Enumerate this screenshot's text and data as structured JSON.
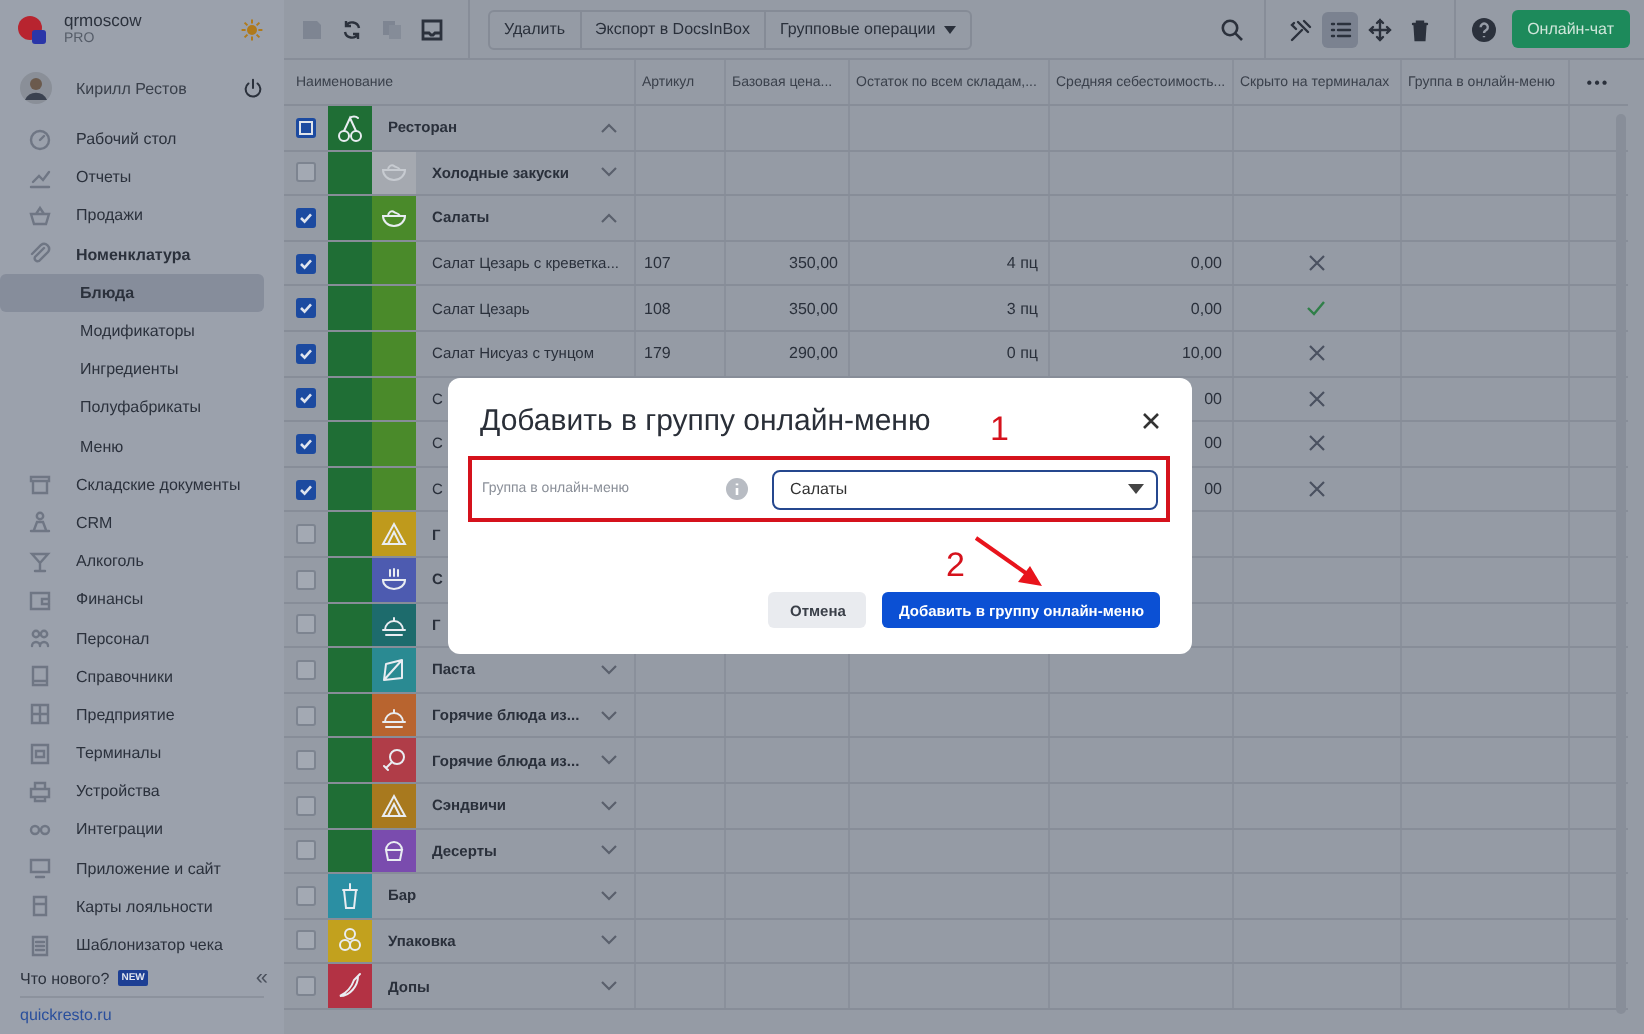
{
  "app": {
    "account": "qrmoscow",
    "plan": "PRO"
  },
  "user": {
    "name": "Кирилл Рестов"
  },
  "sidebar": {
    "items": [
      {
        "label": "Рабочий стол",
        "selected": false
      },
      {
        "label": "Отчеты",
        "selected": false
      },
      {
        "label": "Продажи",
        "selected": false
      },
      {
        "label": "Номенклатура",
        "selected": false,
        "expanded": true,
        "children": [
          {
            "label": "Блюда",
            "selected": true
          },
          {
            "label": "Модификаторы",
            "selected": false
          },
          {
            "label": "Ингредиенты",
            "selected": false
          },
          {
            "label": "Полуфабрикаты",
            "selected": false
          },
          {
            "label": "Меню",
            "selected": false
          }
        ]
      },
      {
        "label": "Складские документы",
        "selected": false
      },
      {
        "label": "CRM",
        "selected": false
      },
      {
        "label": "Алкоголь",
        "selected": false
      },
      {
        "label": "Финансы",
        "selected": false
      },
      {
        "label": "Персонал",
        "selected": false
      },
      {
        "label": "Справочники",
        "selected": false
      },
      {
        "label": "Предприятие",
        "selected": false
      },
      {
        "label": "Терминалы",
        "selected": false
      },
      {
        "label": "Устройства",
        "selected": false
      },
      {
        "label": "Интеграции",
        "selected": false
      },
      {
        "label": "Приложение и сайт",
        "selected": false
      },
      {
        "label": "Карты лояльности",
        "selected": false
      },
      {
        "label": "Шаблонизатор чека",
        "selected": false
      }
    ],
    "whats_new": {
      "label": "Что нового?",
      "badge": "NEW"
    },
    "collapse": "«",
    "site_link": "quickresto.ru"
  },
  "toolbar": {
    "actions": [
      "Удалить",
      "Экспорт в DocsInBox",
      "Групповые операции"
    ],
    "tools": [
      {
        "kind": "tools",
        "selected": false
      },
      {
        "kind": "list",
        "selected": true
      },
      {
        "kind": "move",
        "selected": false
      },
      {
        "kind": "delete",
        "selected": false
      }
    ],
    "chat_button": "Онлайн-чат"
  },
  "table": {
    "columns": [
      "Наименование",
      "Артикул",
      "Базовая цена...",
      "Остаток по всем складам,...",
      "Средняя себестоимость...",
      "Скрыто на терминалах",
      "Группа в онлайн-меню"
    ],
    "more": "•••",
    "rows": [
      {
        "kind": "group",
        "name": "Ресторан",
        "color": "#1f6e35",
        "checked": false,
        "partial": true,
        "expanded": true,
        "children": [
          {
            "kind": "group",
            "name": "Холодные закуски",
            "color": "#a5a9b0",
            "checked": false,
            "partial": false,
            "expanded": false
          },
          {
            "kind": "group",
            "name": "Салаты",
            "color": "#4a8a2a",
            "checked": true,
            "partial": false,
            "expanded": true,
            "children": [
              {
                "kind": "item",
                "name": "Салат Цезарь с креветка...",
                "checked": true,
                "partial": false,
                "article": "107",
                "price": "350,00",
                "stock": "4 пц",
                "cost": "0,00",
                "hidden": false
              },
              {
                "kind": "item",
                "name": "Салат Цезарь",
                "checked": true,
                "partial": false,
                "article": "108",
                "price": "350,00",
                "stock": "3 пц",
                "cost": "0,00",
                "hidden": true
              },
              {
                "kind": "item",
                "name": "Салат Нисуаз с тунцом",
                "checked": true,
                "partial": false,
                "article": "179",
                "price": "290,00",
                "stock": "0 пц",
                "cost": "10,00",
                "hidden": false
              },
              {
                "kind": "item",
                "name": "С",
                "checked": true,
                "partial": false,
                "cost": "00",
                "hidden": false
              },
              {
                "kind": "item",
                "name": "С",
                "checked": true,
                "partial": false,
                "cost": "00",
                "hidden": false
              },
              {
                "kind": "item",
                "name": "С",
                "checked": true,
                "partial": false,
                "cost": "00",
                "hidden": false
              }
            ]
          },
          {
            "kind": "group",
            "name": "Г",
            "color": "#bf9a1c",
            "checked": false,
            "partial": false
          },
          {
            "kind": "group",
            "name": "С",
            "color": "#4d5bb0",
            "checked": false,
            "partial": false
          },
          {
            "kind": "group",
            "name": "Г",
            "color": "#1d6b6c",
            "checked": false,
            "partial": false
          },
          {
            "kind": "group",
            "name": "Паста",
            "color": "#2a8a92",
            "checked": false,
            "partial": false,
            "expanded": false
          },
          {
            "kind": "group",
            "name": "Горячие блюда из...",
            "color": "#b8642f",
            "checked": false,
            "partial": false,
            "expanded": false
          },
          {
            "kind": "group",
            "name": "Горячие блюда из...",
            "color": "#b03d48",
            "checked": false,
            "partial": false,
            "expanded": false
          },
          {
            "kind": "group",
            "name": "Сэндвичи",
            "color": "#a8791e",
            "checked": false,
            "partial": false,
            "expanded": false
          },
          {
            "kind": "group",
            "name": "Десерты",
            "color": "#7a4cae",
            "checked": false,
            "partial": false,
            "expanded": false
          }
        ]
      },
      {
        "kind": "group",
        "name": "Бар",
        "color": "#2b8fa3",
        "checked": false,
        "partial": false,
        "expanded": false
      },
      {
        "kind": "group",
        "name": "Упаковка",
        "color": "#c2a11e",
        "checked": false,
        "partial": false,
        "expanded": false
      },
      {
        "kind": "group",
        "name": "Допы",
        "color": "#b33244",
        "checked": false,
        "partial": false,
        "expanded": false
      }
    ]
  },
  "dialog": {
    "title": "Добавить в группу онлайн-меню",
    "field_label": "Группа в онлайн-меню",
    "field_value": "Салаты",
    "cancel": "Отмена",
    "submit": "Добавить в группу онлайн-меню",
    "annotations": [
      "1",
      "2"
    ]
  }
}
